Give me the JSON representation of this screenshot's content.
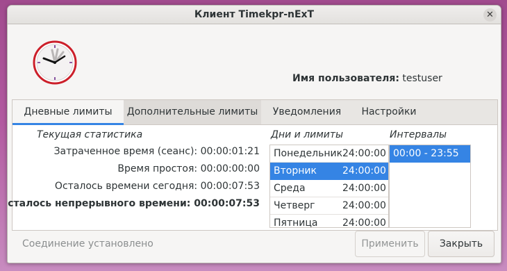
{
  "window": {
    "title": "Клиент Timekpr-nExT",
    "close_glyph": "✕"
  },
  "user": {
    "label": "Имя пользователя:",
    "value": "testuser"
  },
  "tabs": [
    {
      "label": "Дневные лимиты"
    },
    {
      "label": "Дополнительные лимиты"
    },
    {
      "label": "Уведомления"
    },
    {
      "label": "Настройки"
    }
  ],
  "stats": {
    "header": "Текущая статистика",
    "rows": [
      {
        "label": "Затраченное время (сеанс):",
        "value": "00:00:01:21"
      },
      {
        "label": "Время простоя:",
        "value": "00:00:00:00"
      },
      {
        "label": "Осталось времени сегодня:",
        "value": "00:00:07:53"
      },
      {
        "label": "Осталось непрерывного времени:",
        "value": "00:00:07:53"
      }
    ]
  },
  "days": {
    "header": "Дни и лимиты",
    "items": [
      {
        "day": "Понедельник",
        "limit": "24:00:00"
      },
      {
        "day": "Вторник",
        "limit": "24:00:00"
      },
      {
        "day": "Среда",
        "limit": "24:00:00"
      },
      {
        "day": "Четверг",
        "limit": "24:00:00"
      },
      {
        "day": "Пятница",
        "limit": "24:00:00"
      }
    ]
  },
  "intervals": {
    "header": "Интервалы",
    "items": [
      "00:00 - 23:55"
    ]
  },
  "footer": {
    "status": "Соединение установлено",
    "apply_label": "Применить",
    "close_label": "Закрыть"
  },
  "colors": {
    "accent": "#3584e4",
    "clock_rim": "#cc1f2a"
  }
}
